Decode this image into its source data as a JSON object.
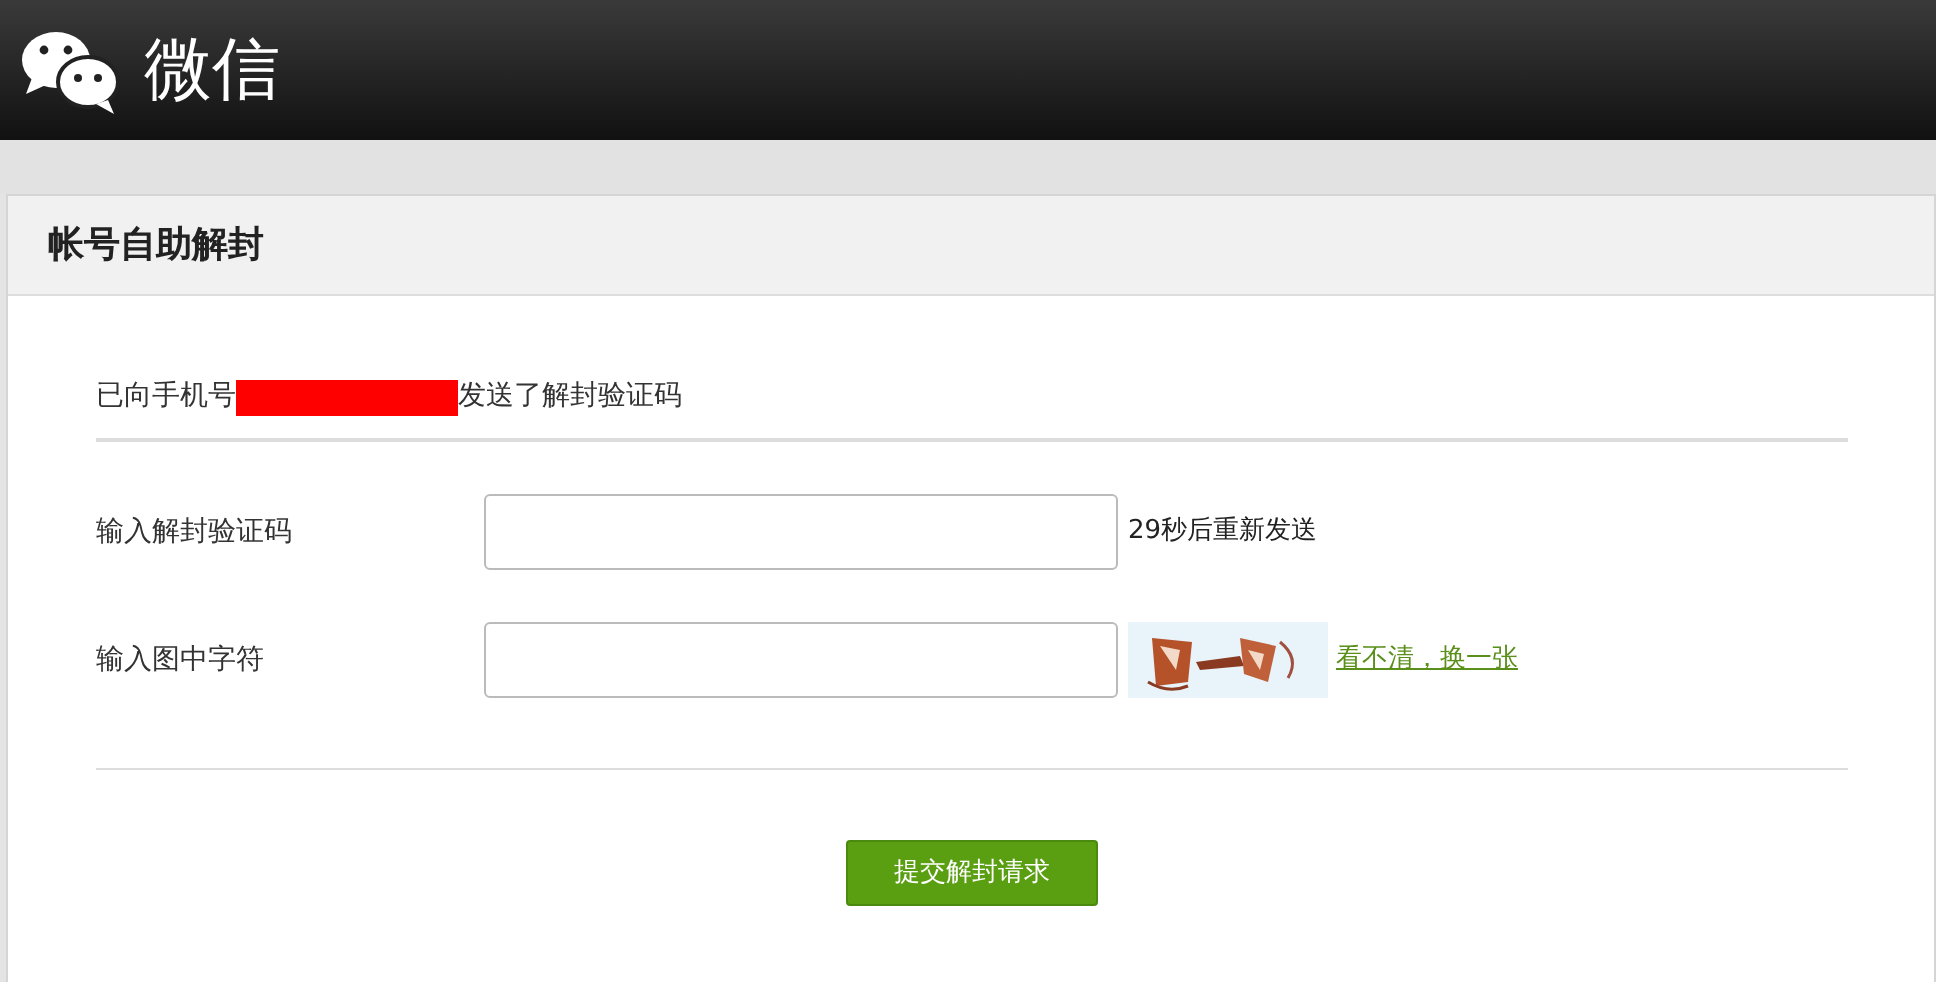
{
  "header": {
    "brand": "微信"
  },
  "panel": {
    "title": "帐号自助解封"
  },
  "notice": {
    "before": "已向手机号",
    "redacted": true,
    "after": "发送了解封验证码"
  },
  "fields": [
    {
      "kind": "text",
      "label": "输入解封验证码",
      "hint": "29秒后重新发送"
    },
    {
      "kind": "captcha",
      "label": "输入图中字符",
      "link": "看不清，换一张"
    }
  ],
  "submit": {
    "label": "提交解封请求"
  }
}
